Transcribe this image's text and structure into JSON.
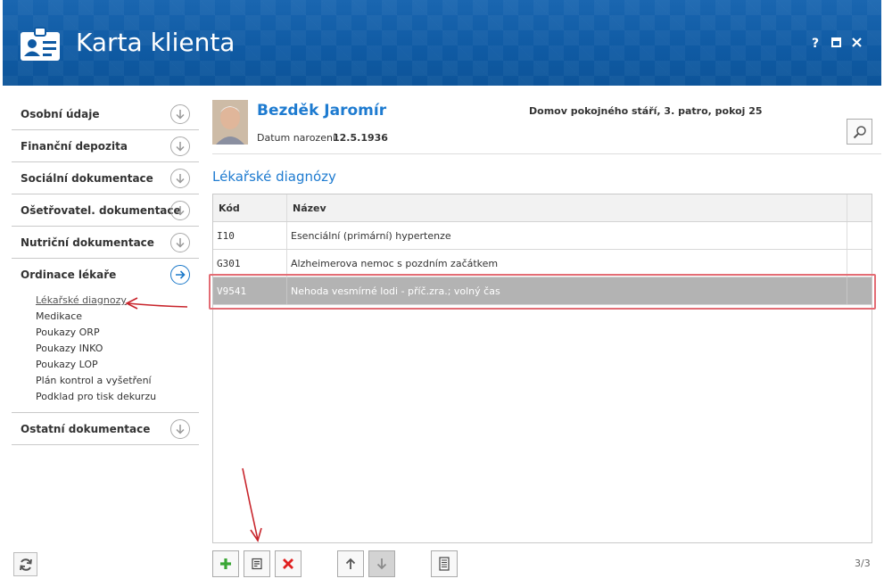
{
  "window": {
    "title": "Karta klienta",
    "controls": [
      "?",
      "□",
      "✕"
    ]
  },
  "sidebar": {
    "sections": [
      {
        "label": "Osobní údaje"
      },
      {
        "label": "Finanční depozita"
      },
      {
        "label": "Sociální dokumentace"
      },
      {
        "label": "Ošetřovatel. dokumentace"
      },
      {
        "label": "Nutriční dokumentace"
      },
      {
        "label": "Ordinace lékaře"
      },
      {
        "label": "Ostatní dokumentace"
      }
    ],
    "ordinace_items": [
      "Lékařské diagnozy",
      "Medikace",
      "Poukazy ORP",
      "Poukazy INKO",
      "Poukazy LOP",
      "Plán kontrol a vyšetření",
      "Podklad pro tisk dekurzu"
    ]
  },
  "client": {
    "name": "Bezděk Jaromír",
    "dob_label": "Datum narození:",
    "dob": "12.5.1936",
    "address": "Domov pokojného stáří, 3. patro, pokoj 25"
  },
  "section_title": "Lékařské diagnózy",
  "grid": {
    "columns": [
      "Kód",
      "Název"
    ],
    "rows": [
      {
        "kod": "I10",
        "nazev": "Esenciální (primární) hypertenze"
      },
      {
        "kod": "G301",
        "nazev": "Alzheimerova nemoc s pozdním začátkem"
      },
      {
        "kod": "V9541",
        "nazev": "Nehoda vesmírné lodi - příč.zra.; volný čas"
      }
    ]
  },
  "pager": "3/3",
  "colors": {
    "header_blue": "#0f5aa3",
    "accent_blue": "#1e7bd0",
    "selected_row": "#b3b3b3",
    "highlight_red": "#e36c74",
    "add_green": "#3aa635",
    "delete_red": "#e02020"
  },
  "icons": {
    "header": "client-card-icon",
    "refresh": "refresh-icon",
    "search": "search-icon",
    "add": "plus-icon",
    "edit": "edit-icon",
    "delete": "delete-icon",
    "up": "arrow-up-icon",
    "down": "arrow-down-icon",
    "print": "document-icon"
  }
}
